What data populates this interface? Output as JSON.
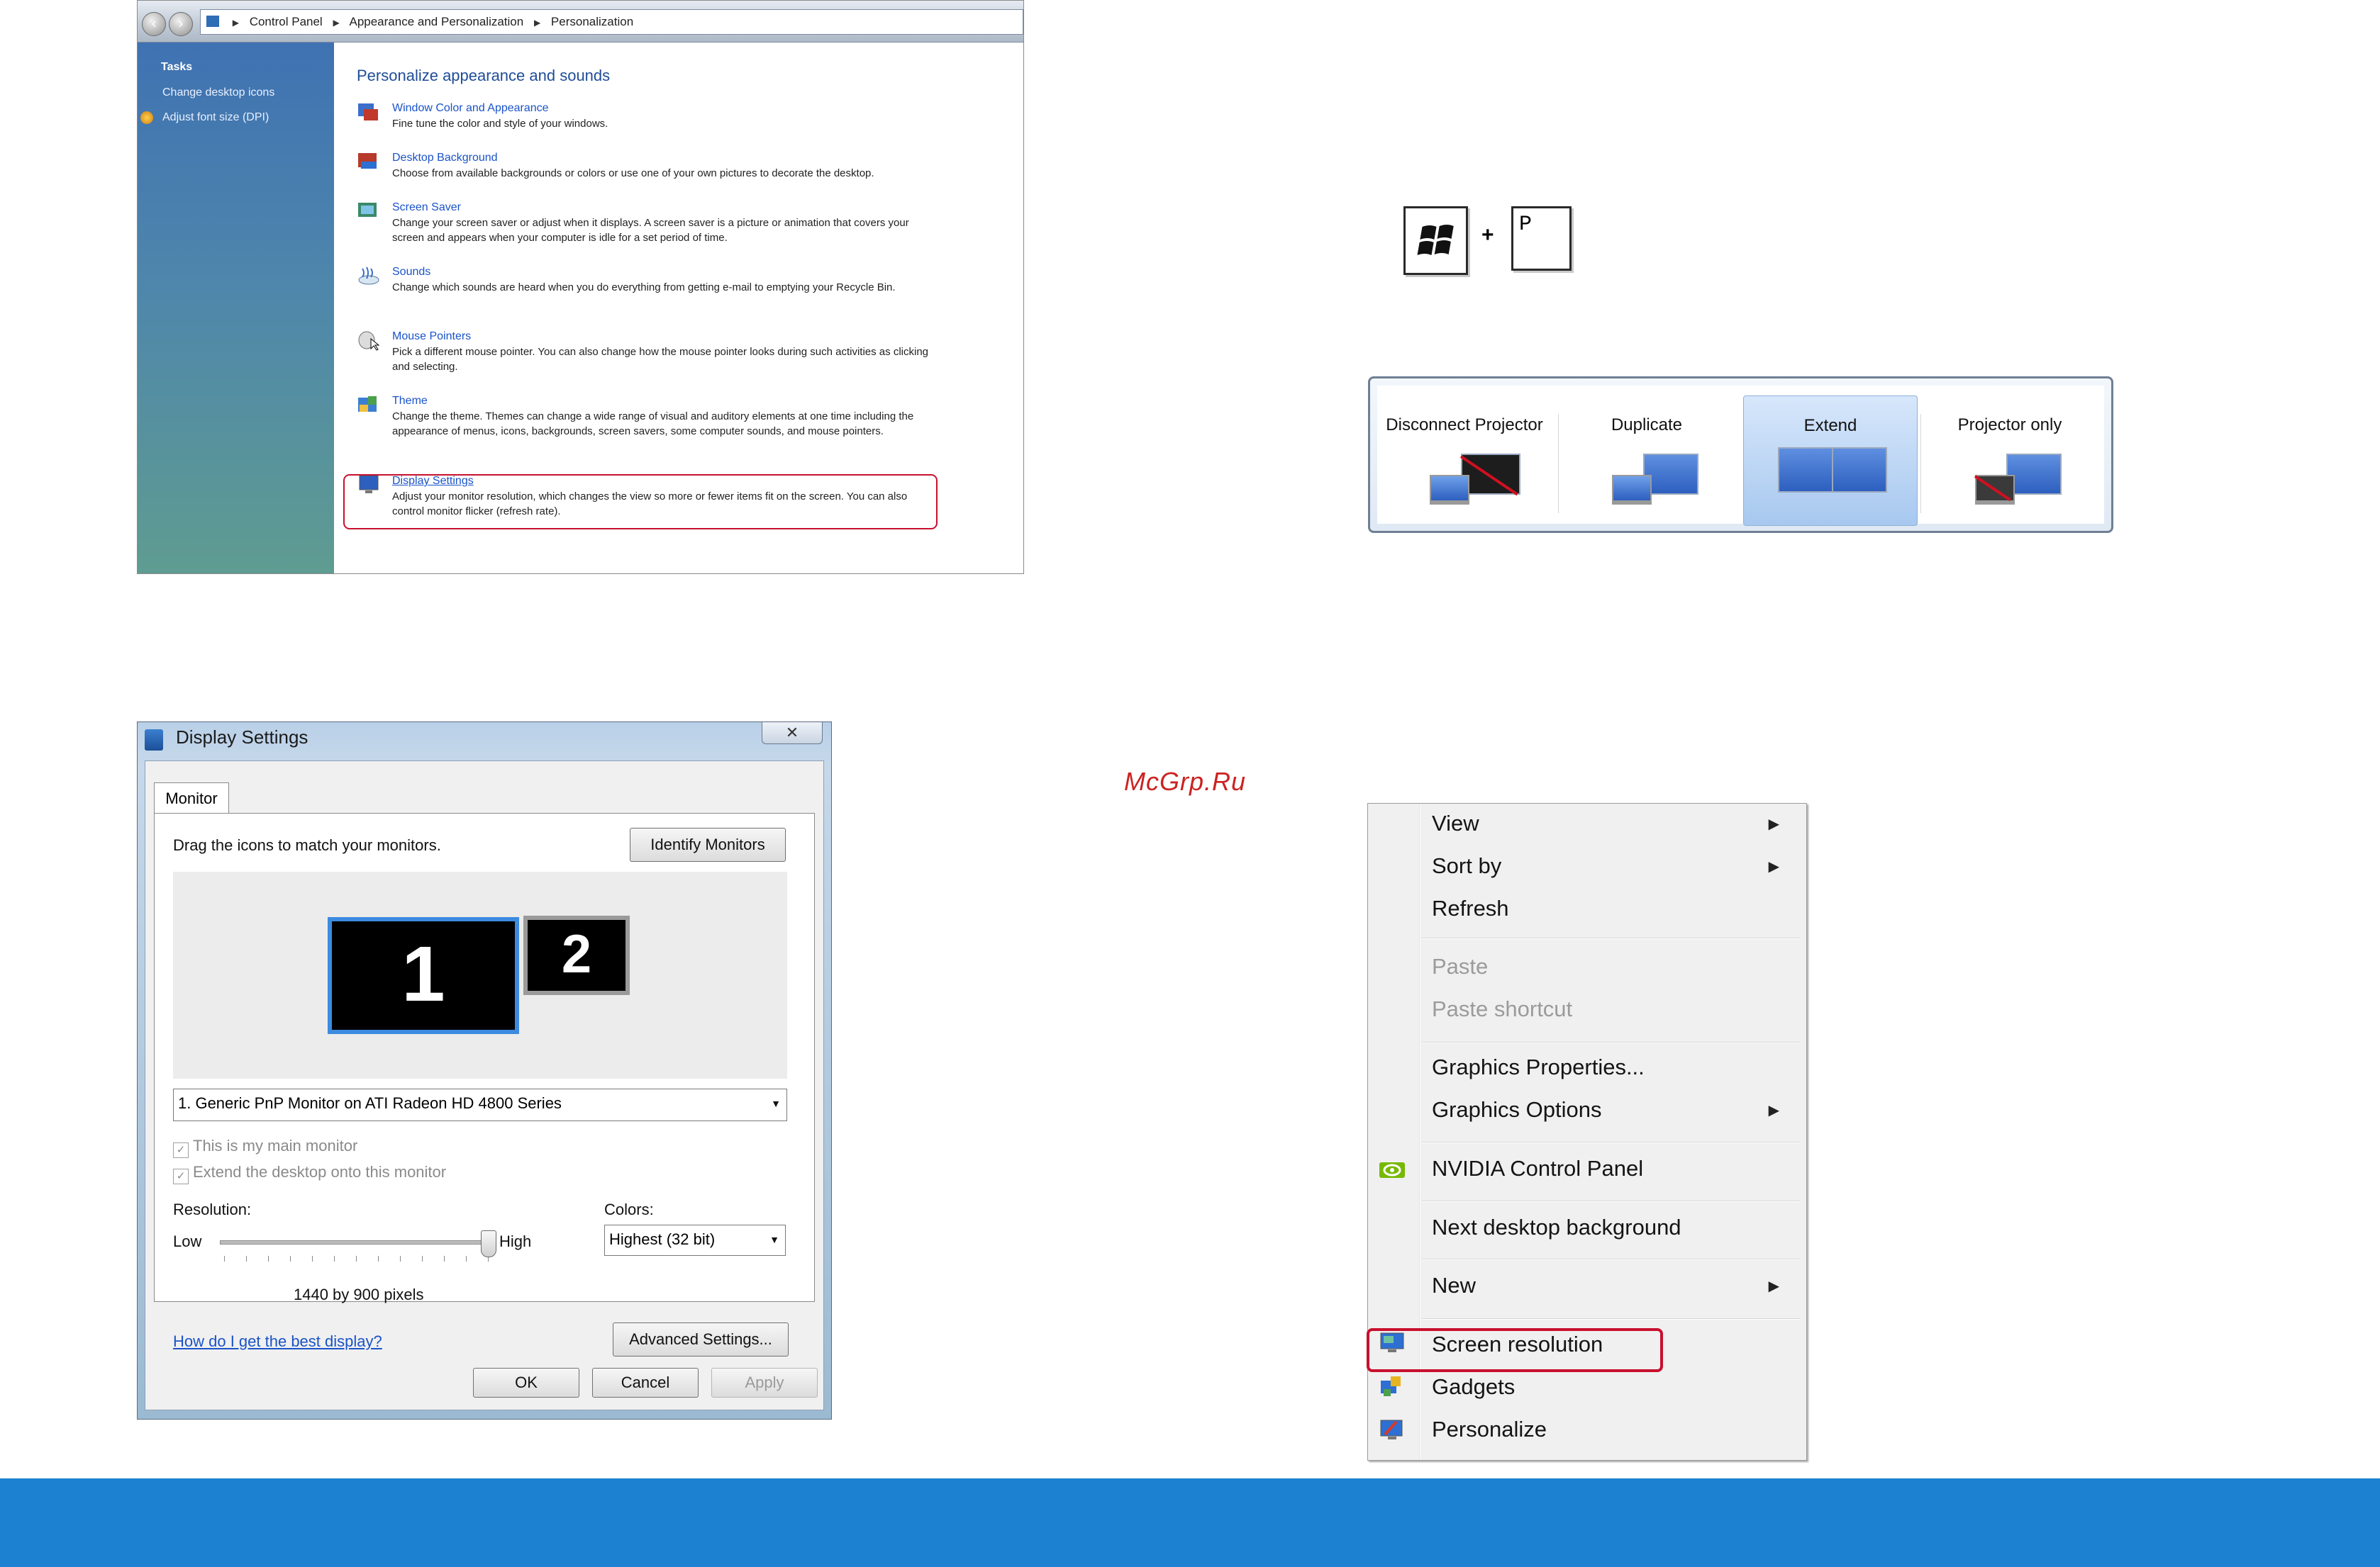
{
  "control_panel": {
    "breadcrumb": [
      "Control Panel",
      "Appearance and Personalization",
      "Personalization"
    ],
    "tasks_heading": "Tasks",
    "tasks": [
      "Change desktop icons",
      "Adjust font size (DPI)"
    ],
    "title": "Personalize appearance and sounds",
    "items": [
      {
        "icon": "window-color-icon",
        "title": "Window Color and Appearance",
        "desc": "Fine tune the color and style of your windows."
      },
      {
        "icon": "desktop-background-icon",
        "title": "Desktop Background",
        "desc": "Choose from available backgrounds or colors or use one of your own pictures to decorate the desktop."
      },
      {
        "icon": "screen-saver-icon",
        "title": "Screen Saver",
        "desc": "Change your screen saver or adjust when it displays. A screen saver is a picture or animation that covers your screen and appears when your computer is idle for a set period of time."
      },
      {
        "icon": "sounds-icon",
        "title": "Sounds",
        "desc": "Change which sounds are heard when you do everything from getting e-mail to emptying your Recycle Bin."
      },
      {
        "icon": "mouse-pointer-icon",
        "title": "Mouse Pointers",
        "desc": "Pick a different mouse pointer. You can also change how the mouse pointer looks during such activities as clicking and selecting."
      },
      {
        "icon": "theme-icon",
        "title": "Theme",
        "desc": "Change the theme. Themes can change a wide range of visual and auditory elements at one time including the appearance of menus, icons, backgrounds, screen savers, some computer sounds, and mouse pointers."
      },
      {
        "icon": "display-settings-icon",
        "title": "Display Settings",
        "desc": "Adjust your monitor resolution, which changes the view so more or fewer items fit on the screen. You can also control monitor flicker (refresh rate)."
      }
    ]
  },
  "shortcut": {
    "plus": "+",
    "key": "P"
  },
  "projector": {
    "options": [
      "Disconnect Projector",
      "Duplicate",
      "Extend",
      "Projector only"
    ],
    "selected": "Extend"
  },
  "display_settings": {
    "title": "Display Settings",
    "close": "✕",
    "tab": "Monitor",
    "instruction": "Drag the icons to match your monitors.",
    "identify_button": "Identify Monitors",
    "monitor_1": "1",
    "monitor_2": "2",
    "monitor_select": "1. Generic PnP Monitor on ATI Radeon HD 4800 Series",
    "main_monitor": "This is my main monitor",
    "extend_desktop": "Extend the desktop onto this monitor",
    "resolution_label": "Resolution:",
    "low": "Low",
    "high": "High",
    "resolution_level": 1.0,
    "resolution_value": "1440 by 900 pixels",
    "colors_label": "Colors:",
    "colors_value": "Highest (32 bit)",
    "help_link": "How do I get the best display?",
    "advanced_button": "Advanced Settings...",
    "ok": "OK",
    "cancel": "Cancel",
    "apply": "Apply"
  },
  "watermark": "McGrp.Ru",
  "context_menu": {
    "items": [
      "View",
      "Sort by",
      "Refresh",
      "Paste",
      "Paste shortcut",
      "Graphics Properties...",
      "Graphics Options",
      "NVIDIA Control Panel",
      "Next desktop background",
      "New",
      "Screen resolution",
      "Gadgets",
      "Personalize"
    ],
    "highlighted": "Screen resolution"
  },
  "colors": {
    "highlight_red": "#c8102e",
    "footer_blue": "#1c81d0",
    "link_blue": "#1a53c8"
  }
}
